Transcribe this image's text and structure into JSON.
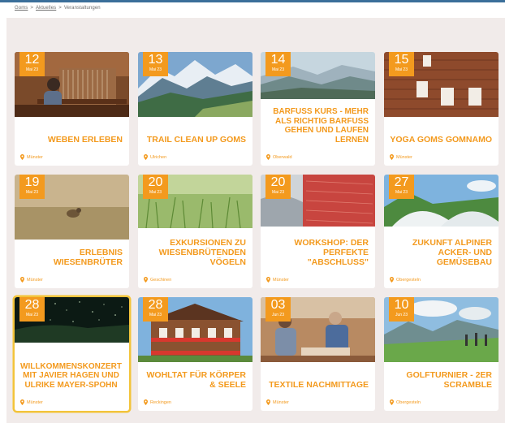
{
  "breadcrumb": {
    "items": [
      "Goms",
      "Aktuelles",
      "Veranstaltungen"
    ],
    "separator": ">"
  },
  "colors": {
    "accent": "#f39a1e",
    "panel": "#f1ebea",
    "selected": "#f3c43b"
  },
  "events": [
    {
      "day": "12",
      "month": "Mai 23",
      "title": "Weben erleben",
      "location": "Münster",
      "image": "weaving-loom"
    },
    {
      "day": "13",
      "month": "Mai 23",
      "title": "Trail Clean Up Goms",
      "location": "Ulrichen",
      "image": "mountain-valley"
    },
    {
      "day": "14",
      "month": "Mai 23",
      "title": "Barfuss Kurs - mehr als richtig barfuss gehen und laufen lernen",
      "location": "Oberwald",
      "image": "misty-valley"
    },
    {
      "day": "15",
      "month": "Mai 23",
      "title": "Yoga Goms Gomnamo",
      "location": "Münster",
      "image": "wooden-house"
    },
    {
      "day": "19",
      "month": "Mai 23",
      "title": "Erlebnis Wiesenbrüter",
      "location": "Münster",
      "image": "bird-meadow"
    },
    {
      "day": "20",
      "month": "Mai 23",
      "title": "Exkursionen zu wiesenbrütenden Vögeln",
      "location": "Geschinen",
      "image": "green-grass"
    },
    {
      "day": "20",
      "month": "Mai 23",
      "title": "Workshop: Der perfekte \"Abschluss\"",
      "location": "Münster",
      "image": "knitting"
    },
    {
      "day": "27",
      "month": "Mai 23",
      "title": "Zukunft alpiner Acker- und Gemüsebau",
      "location": "Obergesteln",
      "image": "greenhouse"
    },
    {
      "day": "28",
      "month": "Mai 23",
      "title": "Willkommenskonzert mit Javier Hagen und Ulrike Mayer-Spohn",
      "location": "Münster",
      "image": "starry-night"
    },
    {
      "day": "28",
      "month": "Mai 23",
      "title": "Wohltat für Körper & Seele",
      "location": "Reckingen",
      "image": "chalet-flowers"
    },
    {
      "day": "03",
      "month": "Jun 23",
      "title": "Textile Nachmittage",
      "location": "Münster",
      "image": "textile-workshop"
    },
    {
      "day": "10",
      "month": "Jun 23",
      "title": "Golfturnier - 2er Scramble",
      "location": "Obergesteln",
      "image": "golf-course"
    }
  ]
}
